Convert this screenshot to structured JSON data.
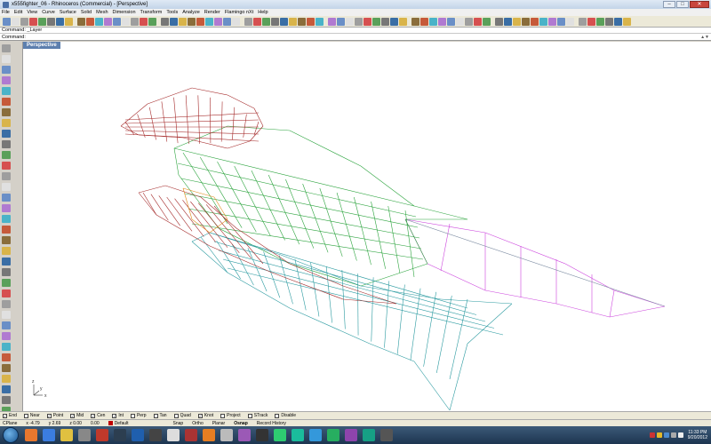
{
  "window": {
    "title": "x555fighter_06 - Rhinoceros (Commercial) - [Perspective]"
  },
  "menu": [
    "File",
    "Edit",
    "View",
    "Curve",
    "Surface",
    "Solid",
    "Mesh",
    "Dimension",
    "Transform",
    "Tools",
    "Analyze",
    "Render",
    "Flamingo nXt",
    "Help"
  ],
  "command": {
    "history": "Command: _Layer",
    "prompt": "Command:"
  },
  "viewport": {
    "label": "Perspective",
    "axis_labels": {
      "x": "x",
      "y": "y",
      "z": "z"
    }
  },
  "osnap": {
    "options": [
      {
        "label": "End",
        "checked": true
      },
      {
        "label": "Near",
        "checked": false
      },
      {
        "label": "Point",
        "checked": true
      },
      {
        "label": "Mid",
        "checked": true
      },
      {
        "label": "Cen",
        "checked": true
      },
      {
        "label": "Int",
        "checked": true
      },
      {
        "label": "Perp",
        "checked": false
      },
      {
        "label": "Tan",
        "checked": false
      },
      {
        "label": "Quad",
        "checked": false
      },
      {
        "label": "Knot",
        "checked": true
      },
      {
        "label": "Project",
        "checked": false
      },
      {
        "label": "STrack",
        "checked": false
      },
      {
        "label": "Disable",
        "checked": false
      }
    ]
  },
  "status": {
    "cplane": "CPlane",
    "x": "x -4.79",
    "y": "y 2.69",
    "z": "z 0.00",
    "d": "0.00",
    "layer": "Default",
    "snap": "Snap",
    "ortho": "Ortho",
    "planar": "Planar",
    "osnap": "Osnap",
    "record_history": "Record History"
  },
  "taskbar": {
    "time": "11:33 PM",
    "date": "9/20/2012"
  },
  "colors": {
    "wire_red": "#a52a2a",
    "wire_green": "#2aa33c",
    "wire_cyan": "#2a9aa0",
    "wire_magenta": "#cc44dd",
    "wire_orange": "#e08a1a",
    "wire_gray": "#7a8aa0",
    "viewport_tab": "#5d7fae"
  }
}
